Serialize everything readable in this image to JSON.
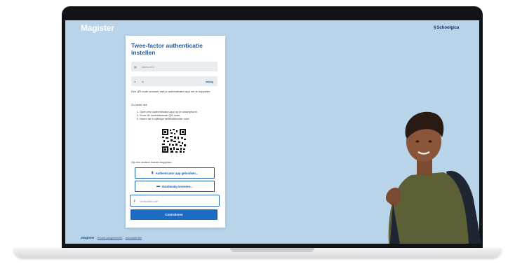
{
  "app": {
    "brand_name": "Magister",
    "brand_dot": ".",
    "partner_name": "Schoolgica",
    "accent": "#1c5aa3"
  },
  "card": {
    "title": "Twee-factor authenticatie instellen",
    "school_field": {
      "icon": "building-icon",
      "value": "Demo VO"
    },
    "user_field": {
      "icon": "user-icon",
      "value": "ai",
      "edit_label": "wijzig"
    },
    "intro": "Een QR-code scanner met je authenticator-app om te koppelen.",
    "how_label": "Zo werkt het:",
    "steps": [
      "Open een authenticator-app op je smartphone.",
      "Scan de onderstaande QR-code.",
      "Neem de 6-cijferige verificatiecode over."
    ],
    "other_label": "Op een andere manier koppelen:",
    "btn_app": "Authenticator app gebruiken...",
    "btn_manual": "Handmatig invoeren...",
    "code_placeholder": "Verificatiecode",
    "submit_label": "Controleren"
  },
  "footer": {
    "brand": "Magister",
    "links": [
      "Snoek aangedreven",
      "Voorwaarden"
    ]
  }
}
